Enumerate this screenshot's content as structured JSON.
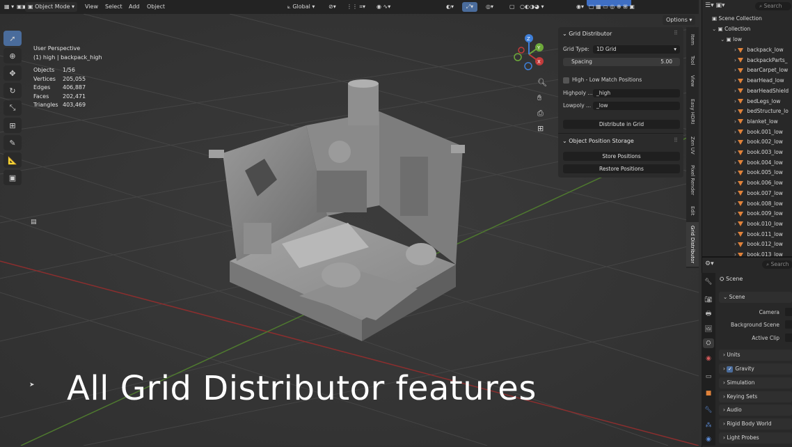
{
  "header": {
    "mode": "Object Mode",
    "menus": [
      "View",
      "Select",
      "Add",
      "Object"
    ],
    "transform_orientation": "Global",
    "options": "Options"
  },
  "viewport": {
    "view_name": "User Perspective",
    "active_object": "(1) high | backpack_high",
    "stats": [
      {
        "key": "Objects",
        "value": "1/56"
      },
      {
        "key": "Vertices",
        "value": "205,055"
      },
      {
        "key": "Edges",
        "value": "406,887"
      },
      {
        "key": "Faces",
        "value": "202,471"
      },
      {
        "key": "Triangles",
        "value": "403,469"
      }
    ],
    "gizmo": {
      "x": "X",
      "y": "Y",
      "z": "Z"
    },
    "caption": "All Grid Distributor features"
  },
  "npanel": {
    "grid_distributor": {
      "title": "Grid Distributor",
      "grid_type_label": "Grid Type:",
      "grid_type_value": "1D Grid",
      "spacing_label": "Spacing",
      "spacing_value": "5.00",
      "match_label": "High - Low Match Positions",
      "highpoly_label": "Highpoly ...",
      "highpoly_value": "_high",
      "lowpoly_label": "Lowpoly ...",
      "lowpoly_value": "_low",
      "distribute_button": "Distribute in Grid"
    },
    "storage": {
      "title": "Object Position Storage",
      "store_button": "Store Positions",
      "restore_button": "Restore Positions"
    },
    "tabs": [
      "Item",
      "Tool",
      "View",
      "Easy HDRI",
      "Zen UV",
      "Pixel Render",
      "Edit",
      "Grid Distributor"
    ]
  },
  "outliner": {
    "search_placeholder": "Search",
    "scene_collection": "Scene Collection",
    "collection": "Collection",
    "low": "low",
    "items": [
      "backpack_low",
      "backpackParts_",
      "bearCarpet_low",
      "bearHead_low",
      "bearHeadShield",
      "bedLegs_low",
      "bedStructure_lo",
      "blanket_low",
      "book.001_low",
      "book.002_low",
      "book.003_low",
      "book.004_low",
      "book.005_low",
      "book.006_low",
      "book.007_low",
      "book.008_low",
      "book.009_low",
      "book.010_low",
      "book.011_low",
      "book.012_low",
      "book.013_low"
    ]
  },
  "properties": {
    "search_placeholder": "Search",
    "scene_header": "Scene",
    "scene_panel": "Scene",
    "camera_label": "Camera",
    "background_label": "Background Scene",
    "clip_label": "Active Clip",
    "sections": [
      "Units",
      "Gravity",
      "Simulation",
      "Keying Sets",
      "Audio",
      "Rigid Body World",
      "Light Probes"
    ]
  },
  "colors": {
    "accent": "#4a6c9c",
    "x_axis": "#c23b3b",
    "y_axis": "#6da83a",
    "z_axis": "#3f7fd8",
    "object_icon": "#e0823a"
  }
}
